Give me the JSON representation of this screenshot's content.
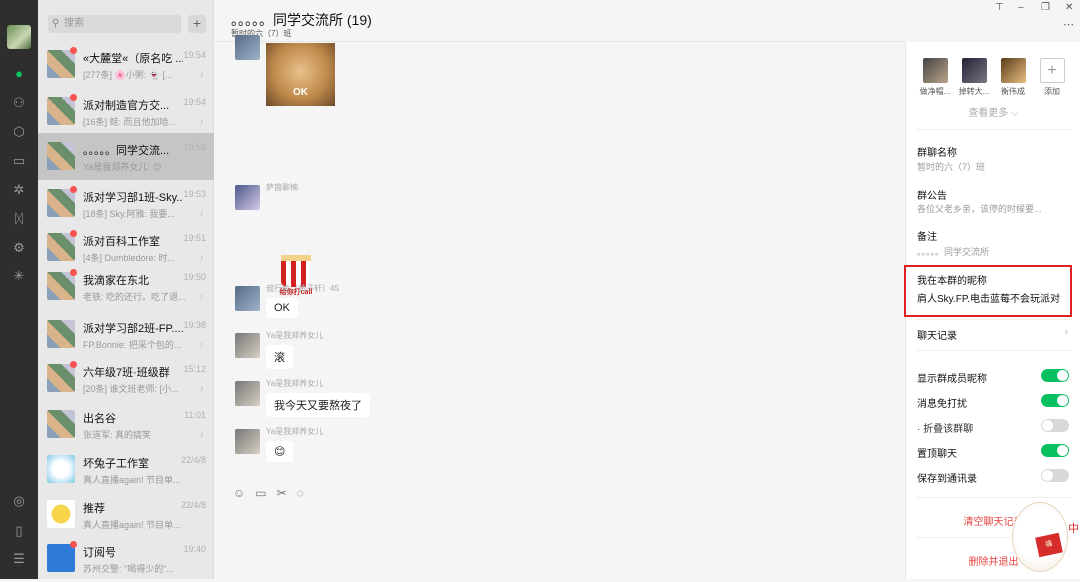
{
  "search": {
    "placeholder": "搜索"
  },
  "chats": [
    {
      "name": "«大麓堂«（原名吃 ...",
      "time": "19:54",
      "preview": "[277条] 🌸小粥: 👻 [..."
    },
    {
      "name": "派对制造官方交...",
      "time": "19:54",
      "preview": "[16条] 鲑: 而且他加哈..."
    },
    {
      "name": "。。。。。同学交流...",
      "time": "19:53",
      "preview": "Ya是我郑养女儿: 😊"
    },
    {
      "name": "派对学习部1班-Sky...",
      "time": "19:53",
      "preview": "[18条] Sky.阿雅: 我要..."
    },
    {
      "name": "派对百科工作室",
      "time": "19:51",
      "preview": "[4条] Dumbledore: 时..."
    },
    {
      "name": "我滴家在东北",
      "time": "19:50",
      "preview": "老铁: 吃的还行。吃了退..."
    },
    {
      "name": "派对学习部2班-FP....",
      "time": "19:38",
      "preview": "FP.Bonnie: 把采个包的..."
    },
    {
      "name": "六年级7班·班级群",
      "time": "15:12",
      "preview": "[20条] 谁文班老师: [小..."
    },
    {
      "name": "出名谷",
      "time": "11:01",
      "preview": "张道军: 真的搞笑"
    },
    {
      "name": "坏兔子工作室",
      "time": "22/4/8",
      "preview": "真人直播again! 节目单..."
    },
    {
      "name": "推荐",
      "time": "22/4/8",
      "preview": "真人直播again! 节目单..."
    },
    {
      "name": "订阅号",
      "time": "19:40",
      "preview": "苏州交警: \"喝得少的\"..."
    }
  ],
  "header": {
    "title": "。。。。。同学交流所 (19)",
    "subtitle": "暂时的六（7）班"
  },
  "messages": {
    "doge_text": "OK",
    "m1_nick": "萨茵聊楠",
    "pop_text": "给你打call",
    "m2_nick": "叔行偷（黄子轩）45",
    "m2_text": "OK",
    "m3_nick": "Ya是我郑养女儿",
    "m3_text": "滚",
    "m4_nick": "Ya是我郑养女儿",
    "m4_text": "我今天又要熬夜了",
    "m5_nick": "Ya是我郑养女儿",
    "m5_text": "😊"
  },
  "toolbar_icons": [
    "emoji-icon",
    "folder-icon",
    "scissors-icon",
    "chat-bubble-icon"
  ],
  "panel": {
    "members": [
      {
        "label": "做净帽..."
      },
      {
        "label": "掉转大..."
      },
      {
        "label": "衡伟成"
      }
    ],
    "add_label": "添加",
    "view_more": "查看更多 ⌵",
    "group_name_label": "群聊名称",
    "group_name_value": "暂时的六（7）班",
    "notice_label": "群公告",
    "notice_value": "各位父老乡亲，该停的时候要...",
    "remark_label": "备注",
    "remark_value": "。。。。。同学交流所",
    "nickname_label": "我在本群的昵称",
    "nickname_value": "肩人Sky.FP.电击蓝莓不会玩派对",
    "history_label": "聊天记录",
    "show_nick_label": "显示群成员昵称",
    "mute_label": "消息免打扰",
    "fold_label": "· 折叠该群聊",
    "pin_label": "置顶聊天",
    "save_label": "保存到通讯录",
    "clear_label": "清空聊天记录",
    "exit_label": "删除并退出"
  },
  "toggles": {
    "show_nick": true,
    "mute": true,
    "fold": false,
    "pin": true,
    "save": false
  },
  "decor": {
    "card_text": "福",
    "side_text": "中"
  }
}
